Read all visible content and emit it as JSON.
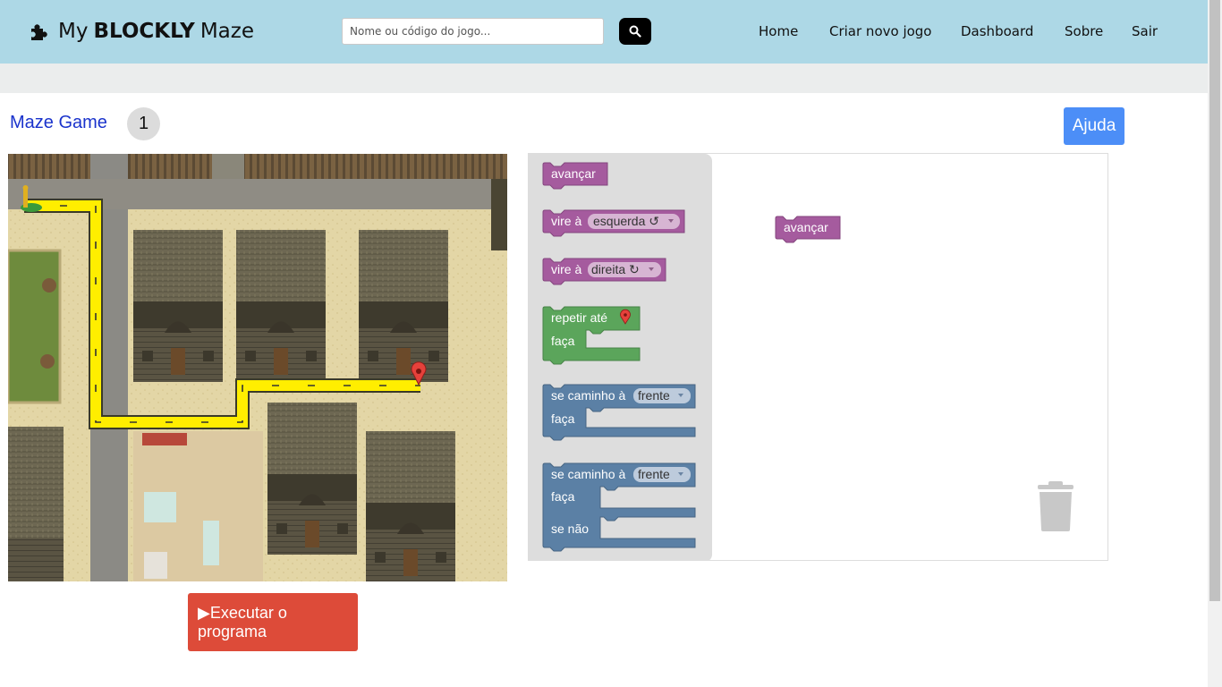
{
  "navbar": {
    "brand_prefix": "My",
    "brand_bold": "BLOCKLY",
    "brand_suffix": "Maze",
    "search_placeholder": "Nome ou código do jogo...",
    "links": [
      "Home",
      "Criar novo jogo",
      "Dashboard",
      "Sobre",
      "Sair"
    ]
  },
  "game": {
    "title": "Maze Game",
    "level": "1",
    "help_label": "Ajuda",
    "run_label": "Executar o programa"
  },
  "toolbox": {
    "move_forward": "avançar",
    "turn_prefix": "vire à",
    "turn_left": "esquerda ↺",
    "turn_right": "direita ↻",
    "repeat_until": "repetir até",
    "do_label": "faça",
    "if_path": "se caminho à",
    "path_ahead": "frente",
    "else_label": "se não"
  },
  "workspace": {
    "placed_block": "avançar"
  },
  "colors": {
    "navbar": "#add8e6",
    "title_link": "#1a33cc",
    "help_button": "#4c8ef7",
    "run_button": "#dd4b39",
    "movement_block": "#a55b9e",
    "loop_block": "#5ba55b",
    "logic_block": "#5b80a5",
    "path": "#ffee00"
  }
}
